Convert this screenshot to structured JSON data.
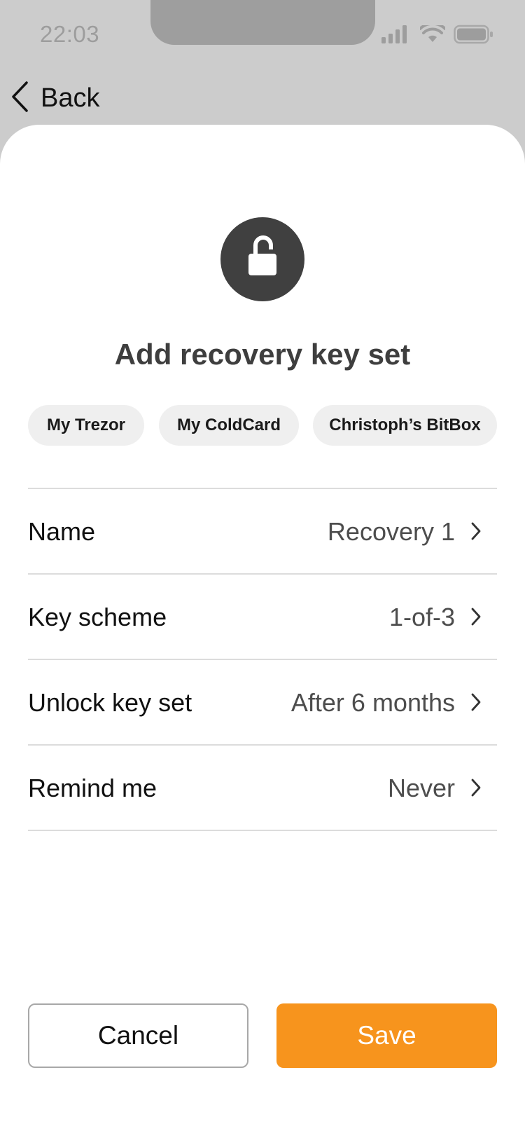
{
  "status_bar": {
    "time": "22:03",
    "icons": [
      "signal-icon",
      "wifi-icon",
      "battery-icon"
    ]
  },
  "nav": {
    "back_label": "Back",
    "back_icon": "chevron-left-icon"
  },
  "header": {
    "icon": "unlocked-padlock-icon",
    "title": "Add recovery key set"
  },
  "keys": [
    {
      "label": "My Trezor"
    },
    {
      "label": "My ColdCard"
    },
    {
      "label": "Christoph’s BitBox"
    }
  ],
  "settings": [
    {
      "label": "Name",
      "value": "Recovery 1"
    },
    {
      "label": "Key scheme",
      "value": "1-of-3"
    },
    {
      "label": "Unlock key set",
      "value": "After 6 months"
    },
    {
      "label": "Remind me",
      "value": "Never"
    }
  ],
  "actions": {
    "cancel_label": "Cancel",
    "save_label": "Save"
  },
  "colors": {
    "accent": "#f7941d",
    "backdrop": "#cccccc",
    "icon_badge": "#404040",
    "chip_background": "#efefef"
  }
}
